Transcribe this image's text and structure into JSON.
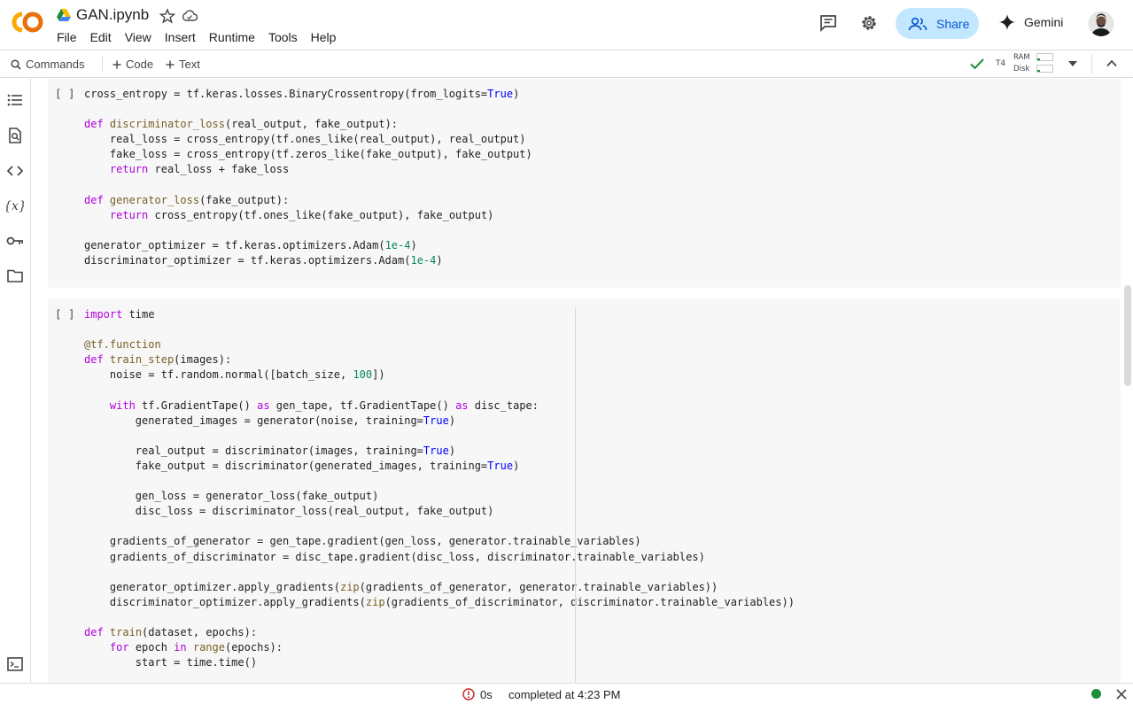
{
  "header": {
    "logo_icon": "colab-logo",
    "title": "GAN.ipynb",
    "menu": [
      "File",
      "Edit",
      "View",
      "Insert",
      "Runtime",
      "Tools",
      "Help"
    ],
    "share_label": "Share",
    "gemini_label": "Gemini",
    "colors": {
      "share_bg": "#c2e7ff",
      "share_text": "#0b57d0",
      "logo_orange": "#f9ab00",
      "logo_dark_orange": "#e8710a"
    }
  },
  "toolbar": {
    "commands_label": "Commands",
    "code_label": "Code",
    "text_label": "Text",
    "gpu_label": "T4",
    "ram_label": "RAM",
    "disk_label": "Disk",
    "ram_usage_fraction": 0.15,
    "disk_usage_fraction": 0.15
  },
  "rail": {
    "icons": [
      "table-of-contents-icon",
      "find-replace-icon",
      "code-snippets-icon",
      "variables-icon",
      "secrets-key-icon",
      "files-folder-icon",
      "terminal-icon"
    ]
  },
  "cells": [
    {
      "marker": "[ ]",
      "lines": [
        "cross_entropy = tf.keras.losses.BinaryCrossentropy(from_logits=True)",
        "",
        "def discriminator_loss(real_output, fake_output):",
        "    real_loss = cross_entropy(tf.ones_like(real_output), real_output)",
        "    fake_loss = cross_entropy(tf.zeros_like(fake_output), fake_output)",
        "    return real_loss + fake_loss",
        "",
        "def generator_loss(fake_output):",
        "    return cross_entropy(tf.ones_like(fake_output), fake_output)",
        "",
        "generator_optimizer = tf.keras.optimizers.Adam(1e-4)",
        "discriminator_optimizer = tf.keras.optimizers.Adam(1e-4)"
      ]
    },
    {
      "marker": "[ ]",
      "lines": [
        "import time",
        "",
        "@tf.function",
        "def train_step(images):",
        "    noise = tf.random.normal([batch_size, 100])",
        "",
        "    with tf.GradientTape() as gen_tape, tf.GradientTape() as disc_tape:",
        "        generated_images = generator(noise, training=True)",
        "",
        "        real_output = discriminator(images, training=True)",
        "        fake_output = discriminator(generated_images, training=True)",
        "",
        "        gen_loss = generator_loss(fake_output)",
        "        disc_loss = discriminator_loss(real_output, fake_output)",
        "",
        "    gradients_of_generator = gen_tape.gradient(gen_loss, generator.trainable_variables)",
        "    gradients_of_discriminator = disc_tape.gradient(disc_loss, discriminator.trainable_variables)",
        "",
        "    generator_optimizer.apply_gradients(zip(gradients_of_generator, generator.trainable_variables))",
        "    discriminator_optimizer.apply_gradients(zip(gradients_of_discriminator, discriminator.trainable_variables))",
        "",
        "def train(dataset, epochs):",
        "    for epoch in range(epochs):",
        "        start = time.time()"
      ]
    }
  ],
  "status": {
    "elapsed": "0s",
    "completed": "completed at 4:23 PM",
    "connected_color": "#1e8e3e"
  }
}
